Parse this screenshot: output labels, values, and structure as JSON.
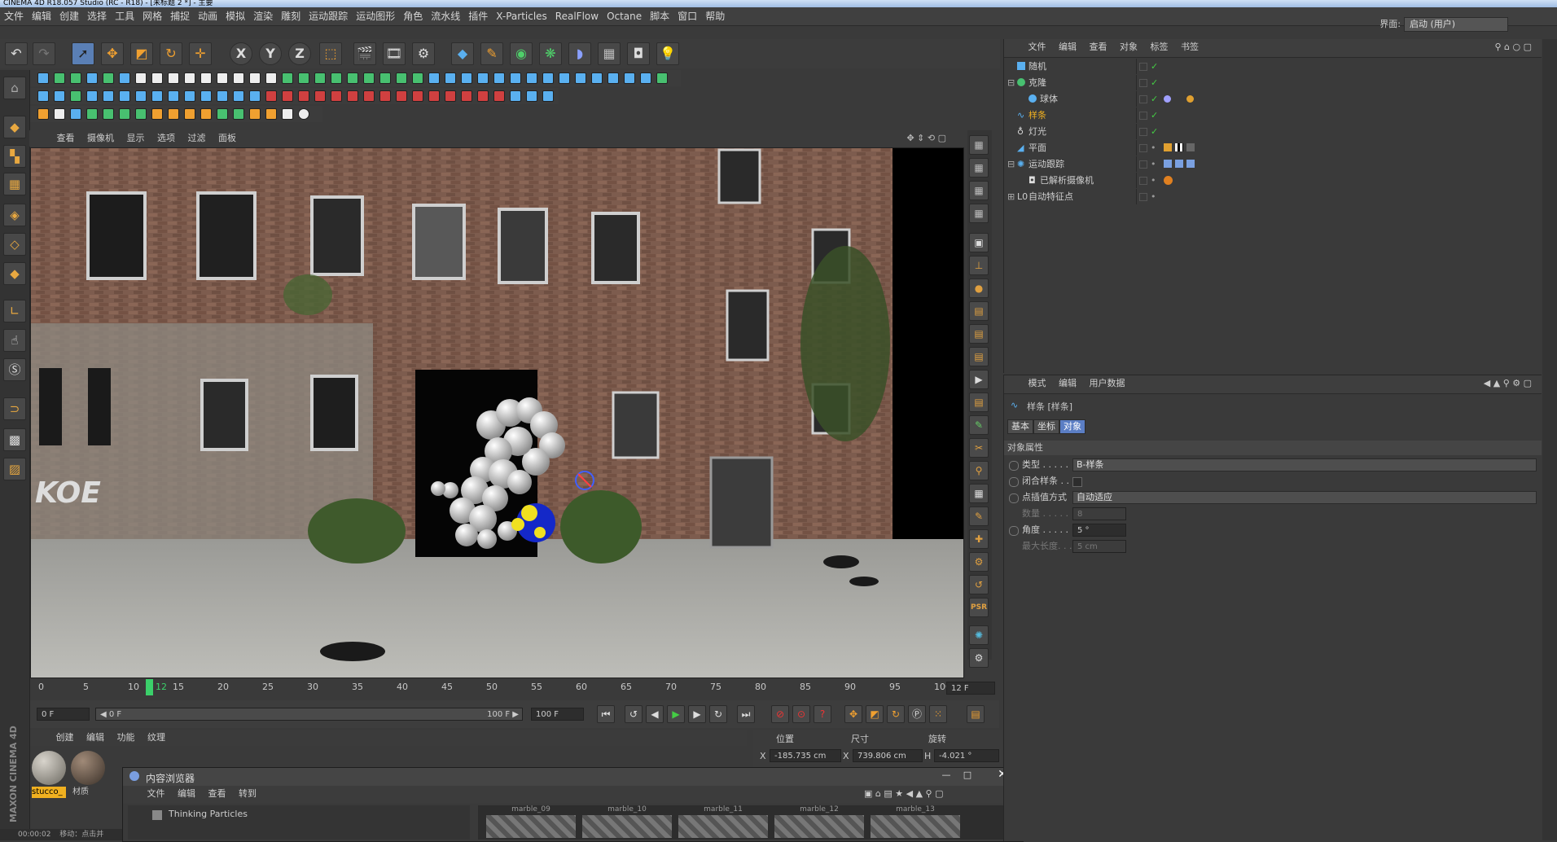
{
  "window": {
    "title": "CINEMA 4D R18.057 Studio (RC - R18) - [未标题 2 *] - 主要"
  },
  "menubar": {
    "items": [
      "文件",
      "编辑",
      "创建",
      "选择",
      "工具",
      "网格",
      "捕捉",
      "动画",
      "模拟",
      "渲染",
      "雕刻",
      "运动跟踪",
      "运动图形",
      "角色",
      "流水线",
      "插件",
      "X-Particles",
      "RealFlow",
      "Octane",
      "脚本",
      "窗口",
      "帮助"
    ],
    "layout_label": "界面:",
    "layout_value": "启动 (用户)"
  },
  "toolbar": {
    "axis_x": "X",
    "axis_y": "Y",
    "axis_z": "Z"
  },
  "viewport_menu": {
    "items": [
      "查看",
      "摄像机",
      "显示",
      "选项",
      "过滤",
      "面板"
    ]
  },
  "timeline": {
    "ticks": [
      "0",
      "5",
      "10",
      "12",
      "15",
      "20",
      "25",
      "30",
      "35",
      "40",
      "45",
      "50",
      "55",
      "60",
      "65",
      "70",
      "75",
      "80",
      "85",
      "90",
      "95",
      "100"
    ],
    "current_frame_label": "12",
    "frame_right": "12 F",
    "start_field": "0 F",
    "range_start": "◀ 0 F",
    "range_end": "100 F ▶",
    "end_field": "100 F"
  },
  "material_menu": {
    "items": [
      "创建",
      "编辑",
      "功能",
      "纹理"
    ],
    "materials": [
      "stucco_",
      "材质"
    ]
  },
  "coords": {
    "headers": [
      "位置",
      "尺寸",
      "旋转"
    ],
    "x_label": "X",
    "x_value": "-185.735 cm",
    "size_label": "X",
    "size_value": "739.806 cm",
    "h_label": "H",
    "h_value": "-4.021 °"
  },
  "content_browser": {
    "title": "内容浏览器",
    "menu": [
      "文件",
      "编辑",
      "查看",
      "转到"
    ],
    "tree_item": "Thinking Particles",
    "thumbs": [
      "marble_09",
      "marble_10",
      "marble_11",
      "marble_12",
      "marble_13"
    ]
  },
  "status": {
    "time": "00:00:02",
    "text": "移动：点击并",
    "brand": "MAXON CINEMA 4D"
  },
  "objects_panel": {
    "menu": [
      "文件",
      "编辑",
      "查看",
      "对象",
      "标签",
      "书签"
    ],
    "objects": [
      {
        "name": "随机",
        "indent": 1
      },
      {
        "name": "克隆",
        "indent": 1
      },
      {
        "name": "球体",
        "indent": 2
      },
      {
        "name": "样条",
        "indent": 1
      },
      {
        "name": "灯光",
        "indent": 1
      },
      {
        "name": "平面",
        "indent": 1
      },
      {
        "name": "运动跟踪",
        "indent": 1
      },
      {
        "name": "已解析摄像机",
        "indent": 2
      },
      {
        "name": "自动特征点",
        "indent": 1
      }
    ]
  },
  "attributes_panel": {
    "menu": [
      "模式",
      "编辑",
      "用户数据"
    ],
    "object_title": "样条 [样条]",
    "tabs": [
      "基本",
      "坐标",
      "对象"
    ],
    "section": "对象属性",
    "rows": [
      {
        "label": "类型 . . . . .",
        "value": "B-样条"
      },
      {
        "label": "闭合样条 . .",
        "value": ""
      },
      {
        "label": "点插值方式",
        "value": "自动适应"
      },
      {
        "label": "数量 . . . . .",
        "value": "8"
      },
      {
        "label": "角度 . . . . .",
        "value": "5 °"
      },
      {
        "label": "最大长度. . .",
        "value": "5 cm"
      }
    ]
  },
  "colors": {
    "accent": "#5b7ec4",
    "panel": "#3a3a3a",
    "selected_object": "#f0b020"
  }
}
